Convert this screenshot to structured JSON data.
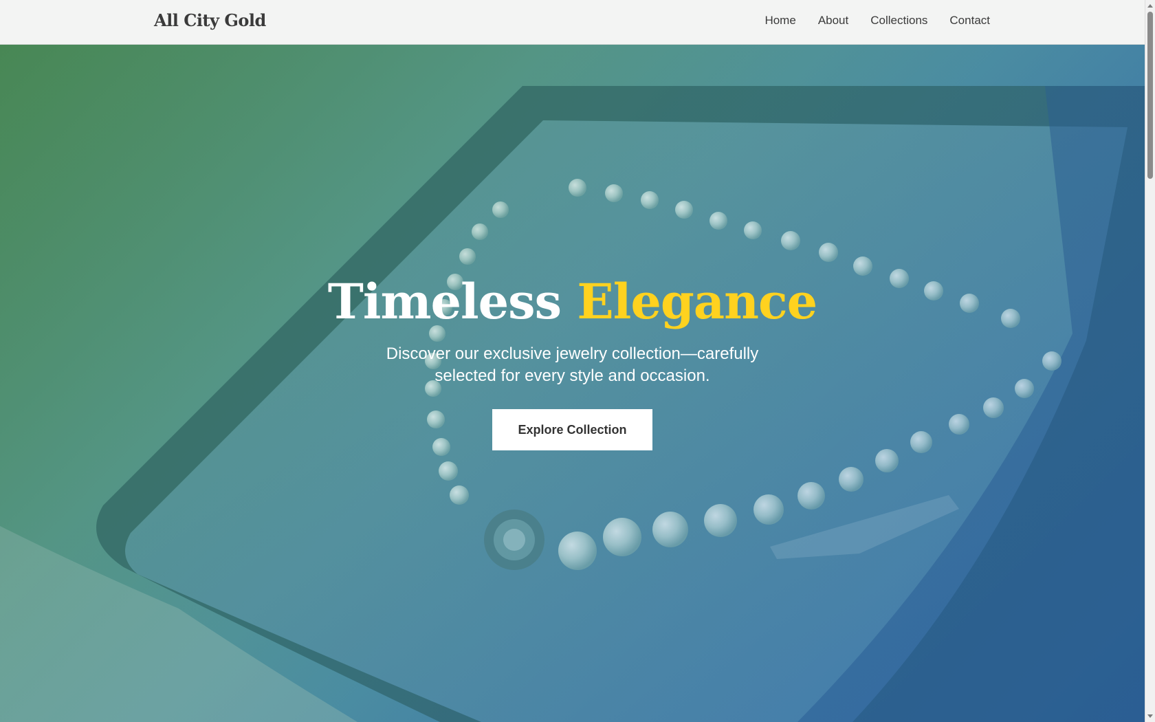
{
  "header": {
    "brand": "All City Gold",
    "nav": [
      {
        "label": "Home"
      },
      {
        "label": "About"
      },
      {
        "label": "Collections"
      },
      {
        "label": "Contact"
      }
    ]
  },
  "hero": {
    "title_main": "Timeless",
    "title_accent": "Elegance",
    "subtitle": "Discover our exclusive jewelry collection—carefully selected for every style and occasion.",
    "cta_label": "Explore Collection"
  },
  "colors": {
    "accent": "#ffd21f",
    "header_bg": "#f3f4f3",
    "hero_gradient_start": "#4f8a5c",
    "hero_gradient_end": "#3468ad"
  },
  "icons": {
    "scroll_up": "triangle-up",
    "scroll_down": "triangle-down"
  }
}
